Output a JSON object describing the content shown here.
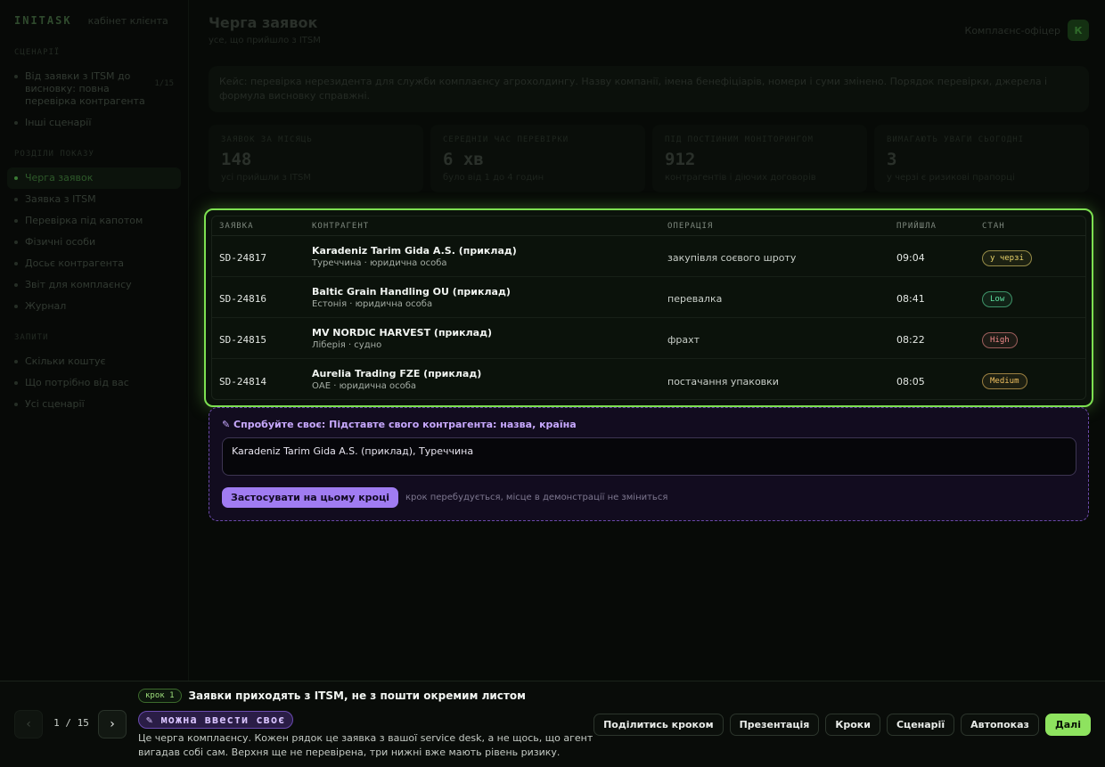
{
  "brand": {
    "name": "INITASK",
    "subtitle": "кабінет клієнта"
  },
  "sidebar": {
    "sections": [
      {
        "title": "СЦЕНАРІЇ",
        "items": [
          {
            "label": "Від заявки з ITSM до висновку: повна перевірка контрагента",
            "meta": "1/15",
            "active": false
          },
          {
            "label": "Інші сценарії",
            "active": false
          }
        ]
      },
      {
        "title": "РОЗДІЛИ ПОКАЗУ",
        "items": [
          {
            "label": "Черга заявок",
            "active": true
          },
          {
            "label": "Заявка з ITSM",
            "active": false
          },
          {
            "label": "Перевірка під капотом",
            "active": false
          },
          {
            "label": "Фізичні особи",
            "active": false
          },
          {
            "label": "Досьє контрагента",
            "active": false
          },
          {
            "label": "Звіт для комплаєнсу",
            "active": false
          },
          {
            "label": "Журнал",
            "active": false
          }
        ]
      },
      {
        "title": "ЗАПИТИ",
        "items": [
          {
            "label": "Скільки коштує",
            "active": false
          },
          {
            "label": "Що потрібно від вас",
            "active": false
          },
          {
            "label": "Усі сценарії",
            "active": false
          }
        ]
      }
    ]
  },
  "header": {
    "title": "Черга заявок",
    "subtitle": "усе, що прийшло з ITSM",
    "company": "Комплаєнс-офіцер",
    "avatar": "К"
  },
  "case_text": "Кейс: перевірка нерезидента для служби комплаєнсу агрохолдингу. Назву компанії, імена бенефіціарів, номери і суми змінено. Порядок перевірки, джерела і формула висновку справжні.",
  "stats": [
    {
      "label": "заявок за місяць",
      "value": "148",
      "note": "усі прийшли з ITSM"
    },
    {
      "label": "середній час перевірки",
      "value": "6 хв",
      "note": "було від 1 до 4 годин"
    },
    {
      "label": "під постійним моніторингом",
      "value": "912",
      "note": "контрагентів і діючих договорів"
    },
    {
      "label": "вимагають уваги сьогодні",
      "value": "3",
      "note": "у черзі є ризикові прапорці"
    }
  ],
  "queue": {
    "columns": [
      "ЗАЯВКА",
      "КОНТРАГЕНТ",
      "ОПЕРАЦІЯ",
      "ПРИЙШЛА",
      "СТАН"
    ],
    "rows": [
      {
        "id": "SD-24817",
        "name": "Karadeniz Tarim Gida A.S. (приклад)",
        "sub": "Туреччина · юридична особа",
        "operation": "закупівля соєвого шроту",
        "time": "09:04",
        "state": "у черзі",
        "state_color": "#e8d36a"
      },
      {
        "id": "SD-24816",
        "name": "Baltic Grain Handling OU (приклад)",
        "sub": "Естонія · юридична особа",
        "operation": "перевалка",
        "time": "08:41",
        "state": "Low",
        "state_color": "#5ee0a0"
      },
      {
        "id": "SD-24815",
        "name": "MV NORDIC HARVEST (приклад)",
        "sub": "Ліберія · судно",
        "operation": "фрахт",
        "time": "08:22",
        "state": "High",
        "state_color": "#f08a8a"
      },
      {
        "id": "SD-24814",
        "name": "Aurelia Trading FZE (приклад)",
        "sub": "ОАЕ · юридична особа",
        "operation": "постачання упаковки",
        "time": "08:05",
        "state": "Medium",
        "state_color": "#f0c060"
      }
    ]
  },
  "try_it": {
    "title": "✎ Спробуйте своє: Підставте свого контрагента: назва, країна",
    "value": "Karadeniz Tarim Gida A.S. (приклад), Туреччина",
    "apply_label": "Застосувати на цьому кроці",
    "hint": "крок перебудується, місце в демонстрації не зміниться"
  },
  "walkthrough": {
    "counter": "1 / 15",
    "step_chip": "крок 1",
    "step_title": "Заявки приходять з ITSM, не з пошти окремим листом",
    "editable_chip": "✎ можна ввести своє",
    "description": "Це черга комплаєнсу. Кожен рядок це заявка з вашої service desk, а не щось, що агент вигадав собі сам. Верхня ще не перевірена, три нижні вже мають рівень ризику.",
    "prev_icon": "‹",
    "next_icon": "›",
    "actions": [
      "Поділитись кроком",
      "Презентація",
      "Кроки",
      "Сценарії",
      "Автопоказ",
      "Далі"
    ]
  }
}
